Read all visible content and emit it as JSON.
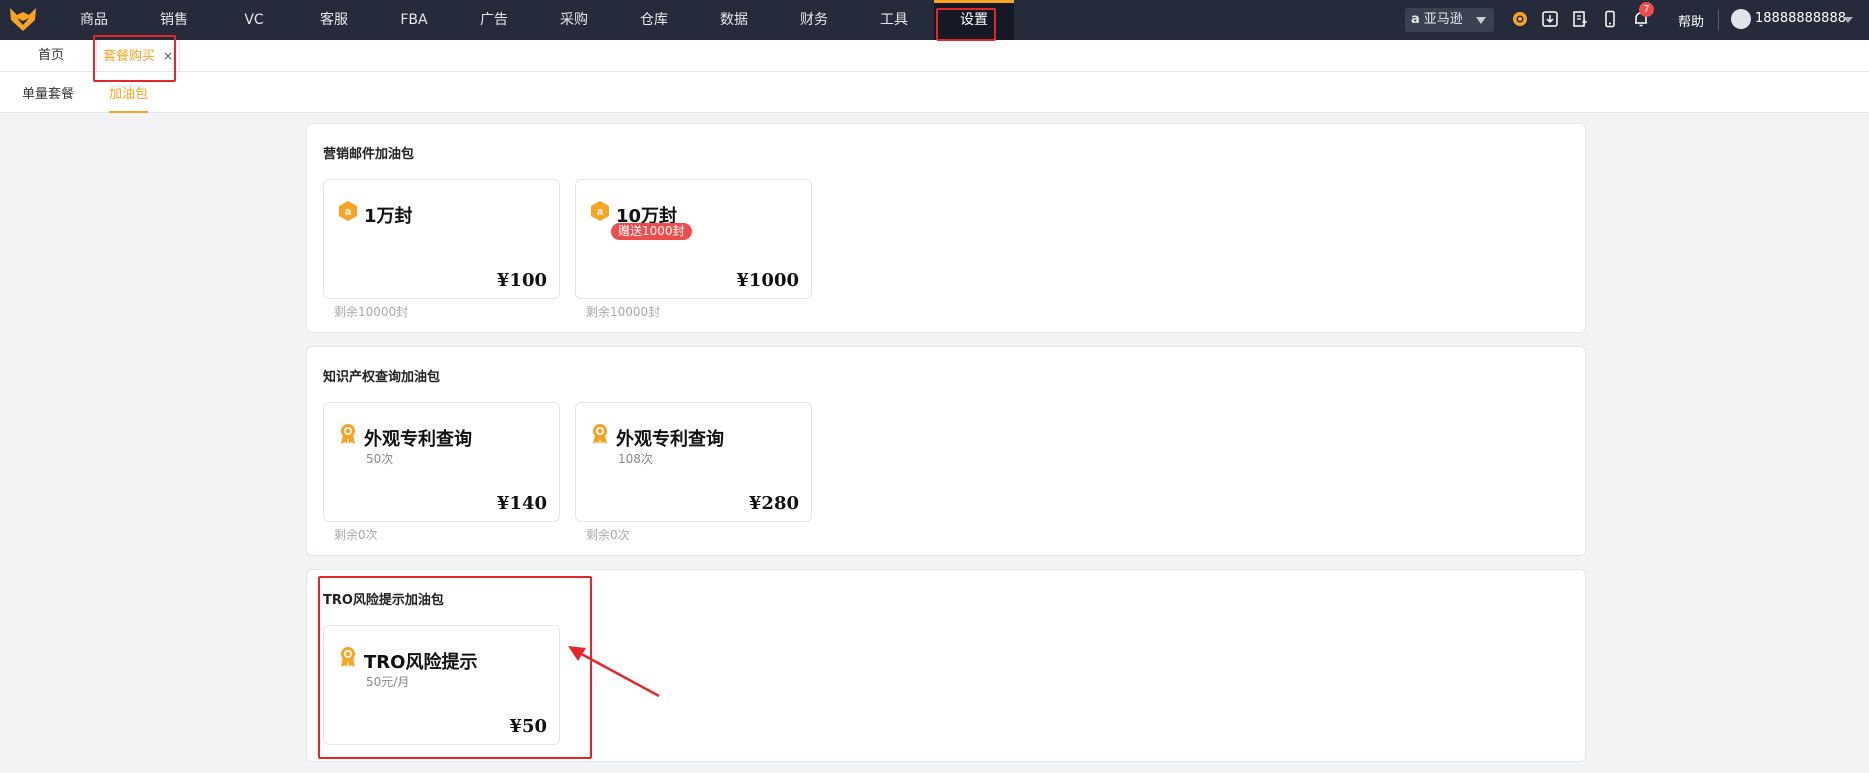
{
  "nav": {
    "items": [
      "商品",
      "销售",
      "VC",
      "客服",
      "FBA",
      "广告",
      "采购",
      "仓库",
      "数据",
      "财务",
      "工具",
      "设置"
    ],
    "active_index": 11
  },
  "header": {
    "shop": "亚马逊",
    "notification_count": "7",
    "help": "帮助",
    "user": "18888888888"
  },
  "tabs": {
    "home": "首页",
    "current": "套餐购买",
    "close": "×"
  },
  "subtabs": [
    "单量套餐",
    "加油包"
  ],
  "sections": [
    {
      "title": "营销邮件加油包",
      "cards": [
        {
          "name": "1万封",
          "sub": "",
          "gift": "",
          "price": "¥100",
          "remain": "剩余10000封",
          "icon": "amazon-coin-icon"
        },
        {
          "name": "10万封",
          "sub": "",
          "gift": "赠送1000封",
          "price": "¥1000",
          "remain": "剩余10000封",
          "icon": "amazon-coin-icon"
        }
      ]
    },
    {
      "title": "知识产权查询加油包",
      "cards": [
        {
          "name": "外观专利查询",
          "sub": "50次",
          "gift": "",
          "price": "¥140",
          "remain": "剩余0次",
          "icon": "medal-icon"
        },
        {
          "name": "外观专利查询",
          "sub": "108次",
          "gift": "",
          "price": "¥280",
          "remain": "剩余0次",
          "icon": "medal-icon"
        }
      ]
    },
    {
      "title": "TRO风险提示加油包",
      "cards": [
        {
          "name": "TRO风险提示",
          "sub": "50元/月",
          "gift": "",
          "price": "¥50",
          "remain": "",
          "icon": "medal-icon"
        }
      ]
    }
  ],
  "colors": {
    "topbar": "#252b3a",
    "accent": "#f7a425",
    "annotation": "#e8262a",
    "gift_badge": "#ef4d4d"
  }
}
